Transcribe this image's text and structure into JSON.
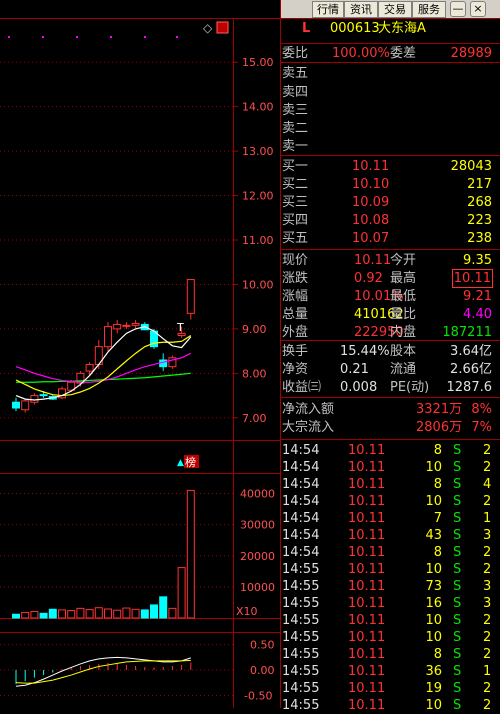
{
  "toolbar": {
    "tabs": [
      "行情",
      "资讯",
      "交易",
      "服务"
    ],
    "min_btn": "—",
    "close_btn": "×"
  },
  "chart_axes": {
    "price_ticks": [
      "15.00",
      "14.00",
      "13.00",
      "12.00",
      "11.00",
      "10.00",
      "9.00",
      "8.00",
      "7.00"
    ],
    "volume_ticks": [
      "40000",
      "30000",
      "20000",
      "10000"
    ],
    "volume_unit": "X10",
    "macd_ticks": [
      "0.50",
      "0.00",
      "-0.50"
    ],
    "annotation": "榜"
  },
  "colors": {
    "up": "#ff3232",
    "down": "#00ffff",
    "ma5": "#ffffff",
    "ma10": "#ffff00",
    "ma20": "#ff00ff",
    "ma60": "#00ff00",
    "grid": "#a00000"
  },
  "quote": {
    "marker": "L",
    "code": "000613",
    "name": "大东海A",
    "weibi_label": "委比",
    "weibi": "100.00%",
    "weicha_label": "委差",
    "weicha": "28989",
    "sell": [
      {
        "label": "卖五"
      },
      {
        "label": "卖四"
      },
      {
        "label": "卖三"
      },
      {
        "label": "卖二"
      },
      {
        "label": "卖一"
      }
    ],
    "buy": [
      {
        "label": "买一",
        "price": "10.11",
        "vol": "28043"
      },
      {
        "label": "买二",
        "price": "10.10",
        "vol": "217"
      },
      {
        "label": "买三",
        "price": "10.09",
        "vol": "268"
      },
      {
        "label": "买四",
        "price": "10.08",
        "vol": "223"
      },
      {
        "label": "买五",
        "price": "10.07",
        "vol": "238"
      }
    ],
    "stats": [
      {
        "l1": "现价",
        "v1": "10.11",
        "l2": "今开",
        "v2": "9.35"
      },
      {
        "l1": "涨跌",
        "v1": "0.92",
        "l2": "最高",
        "v2": "10.11"
      },
      {
        "l1": "涨幅",
        "v1": "10.01%",
        "l2": "最低",
        "v2": "9.21"
      },
      {
        "l1": "总量",
        "v1": "410162",
        "l2": "量比",
        "v2": "4.40"
      },
      {
        "l1": "外盘",
        "v1": "222950",
        "l2": "内盘",
        "v2": "187211"
      }
    ],
    "fund": [
      {
        "l1": "换手",
        "v1": "15.44%",
        "l2": "股本",
        "v2": "3.64亿"
      },
      {
        "l1": "净资",
        "v1": "0.21",
        "l2": "流通",
        "v2": "2.66亿"
      },
      {
        "l1": "收益㈢",
        "v1": "0.008",
        "l2": "PE(动)",
        "v2": "1287.6"
      }
    ],
    "flows": [
      {
        "label": "净流入额",
        "value": "3321万",
        "pct": "8%"
      },
      {
        "label": "大宗流入",
        "value": "2806万",
        "pct": "7%"
      }
    ]
  },
  "ticks": [
    {
      "time": "14:54",
      "price": "10.11",
      "vol": "8",
      "side": "S",
      "n": "2"
    },
    {
      "time": "14:54",
      "price": "10.11",
      "vol": "10",
      "side": "S",
      "n": "2"
    },
    {
      "time": "14:54",
      "price": "10.11",
      "vol": "8",
      "side": "S",
      "n": "4"
    },
    {
      "time": "14:54",
      "price": "10.11",
      "vol": "10",
      "side": "S",
      "n": "2"
    },
    {
      "time": "14:54",
      "price": "10.11",
      "vol": "7",
      "side": "S",
      "n": "1"
    },
    {
      "time": "14:54",
      "price": "10.11",
      "vol": "43",
      "side": "S",
      "n": "3"
    },
    {
      "time": "14:54",
      "price": "10.11",
      "vol": "8",
      "side": "S",
      "n": "2"
    },
    {
      "time": "14:55",
      "price": "10.11",
      "vol": "10",
      "side": "S",
      "n": "2"
    },
    {
      "time": "14:55",
      "price": "10.11",
      "vol": "73",
      "side": "S",
      "n": "3"
    },
    {
      "time": "14:55",
      "price": "10.11",
      "vol": "16",
      "side": "S",
      "n": "3"
    },
    {
      "time": "14:55",
      "price": "10.11",
      "vol": "10",
      "side": "S",
      "n": "2"
    },
    {
      "time": "14:55",
      "price": "10.11",
      "vol": "10",
      "side": "S",
      "n": "2"
    },
    {
      "time": "14:55",
      "price": "10.11",
      "vol": "8",
      "side": "S",
      "n": "2"
    },
    {
      "time": "14:55",
      "price": "10.11",
      "vol": "36",
      "side": "S",
      "n": "1"
    },
    {
      "time": "14:55",
      "price": "10.11",
      "vol": "19",
      "side": "S",
      "n": "2"
    },
    {
      "time": "14:55",
      "price": "10.11",
      "vol": "10",
      "side": "S",
      "n": "2"
    }
  ],
  "chart_data": {
    "type": "candlestick",
    "candles": [
      {
        "o": 7.35,
        "h": 7.45,
        "l": 7.15,
        "c": 7.22
      },
      {
        "o": 7.18,
        "h": 7.42,
        "l": 7.12,
        "c": 7.38
      },
      {
        "o": 7.35,
        "h": 7.55,
        "l": 7.3,
        "c": 7.5
      },
      {
        "o": 7.52,
        "h": 7.6,
        "l": 7.45,
        "c": 7.5
      },
      {
        "o": 7.48,
        "h": 7.52,
        "l": 7.4,
        "c": 7.42
      },
      {
        "o": 7.45,
        "h": 7.7,
        "l": 7.42,
        "c": 7.65
      },
      {
        "o": 7.62,
        "h": 7.85,
        "l": 7.58,
        "c": 7.8
      },
      {
        "o": 7.78,
        "h": 8.05,
        "l": 7.7,
        "c": 8.0
      },
      {
        "o": 8.05,
        "h": 8.25,
        "l": 7.95,
        "c": 8.2
      },
      {
        "o": 8.2,
        "h": 8.75,
        "l": 8.1,
        "c": 8.6
      },
      {
        "o": 8.6,
        "h": 9.15,
        "l": 8.5,
        "c": 9.05
      },
      {
        "o": 9.0,
        "h": 9.2,
        "l": 8.9,
        "c": 9.1
      },
      {
        "o": 9.08,
        "h": 9.15,
        "l": 9.0,
        "c": 9.08
      },
      {
        "o": 9.08,
        "h": 9.2,
        "l": 9.0,
        "c": 9.12
      },
      {
        "o": 9.1,
        "h": 9.15,
        "l": 9.0,
        "c": 8.98
      },
      {
        "o": 8.95,
        "h": 9.0,
        "l": 8.55,
        "c": 8.6
      },
      {
        "o": 8.3,
        "h": 8.45,
        "l": 8.05,
        "c": 8.15
      },
      {
        "o": 8.15,
        "h": 8.4,
        "l": 8.1,
        "c": 8.35
      },
      {
        "o": 8.85,
        "h": 9.05,
        "l": 8.8,
        "c": 8.9
      },
      {
        "o": 9.35,
        "h": 10.11,
        "l": 9.21,
        "c": 10.11
      }
    ],
    "ma5": [
      7.5,
      7.42,
      7.4,
      7.42,
      7.45,
      7.5,
      7.6,
      7.75,
      7.95,
      8.2,
      8.48,
      8.7,
      8.9,
      9.0,
      9.05,
      8.95,
      8.78,
      8.62,
      8.58,
      8.82
    ],
    "ma10": [
      7.85,
      7.75,
      7.65,
      7.58,
      7.52,
      7.5,
      7.52,
      7.58,
      7.66,
      7.78,
      7.92,
      8.1,
      8.28,
      8.45,
      8.6,
      8.68,
      8.7,
      8.7,
      8.72,
      8.85
    ],
    "ma20": [
      8.15,
      8.08,
      8.0,
      7.94,
      7.88,
      7.84,
      7.82,
      7.8,
      7.8,
      7.82,
      7.86,
      7.92,
      8.0,
      8.08,
      8.15,
      8.2,
      8.25,
      8.3,
      8.35,
      8.45
    ],
    "ma60": [
      7.8,
      7.8,
      7.8,
      7.81,
      7.81,
      7.82,
      7.82,
      7.83,
      7.84,
      7.85,
      7.86,
      7.87,
      7.88,
      7.89,
      7.9,
      7.92,
      7.94,
      7.96,
      7.98,
      8.0
    ],
    "volume": [
      1200,
      1800,
      2100,
      1500,
      2800,
      2600,
      2400,
      3100,
      2700,
      3300,
      2900,
      2500,
      3200,
      2800,
      2600,
      4200,
      6800,
      3100,
      16200,
      41016
    ],
    "macd": [
      -0.28,
      -0.22,
      -0.15,
      -0.1,
      -0.05,
      0.02,
      0.05,
      0.08,
      0.1,
      0.12,
      0.14,
      0.12,
      0.1,
      0.08,
      0.06,
      0.05,
      0.06,
      0.08,
      0.1,
      0.15
    ],
    "dif": [
      -0.32,
      -0.3,
      -0.25,
      -0.18,
      -0.1,
      -0.02,
      0.05,
      0.12,
      0.18,
      0.22,
      0.24,
      0.25,
      0.24,
      0.22,
      0.2,
      0.18,
      0.16,
      0.16,
      0.18,
      0.24
    ],
    "dea": [
      -0.25,
      -0.26,
      -0.26,
      -0.23,
      -0.2,
      -0.15,
      -0.1,
      -0.04,
      0.02,
      0.07,
      0.1,
      0.13,
      0.16,
      0.17,
      0.18,
      0.18,
      0.18,
      0.18,
      0.18,
      0.19
    ],
    "price_range": [
      6.5,
      15.5
    ],
    "volume_range": [
      0,
      45000
    ],
    "macd_range": [
      -0.75,
      0.75
    ]
  }
}
